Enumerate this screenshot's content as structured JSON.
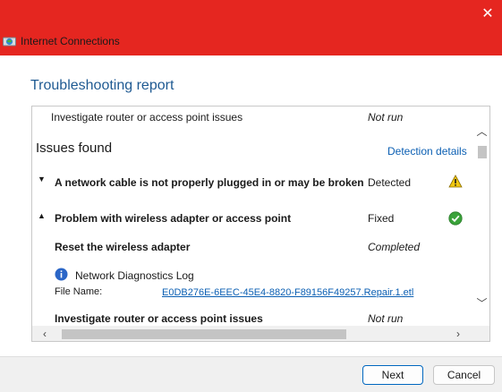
{
  "window": {
    "title": "Internet Connections",
    "close_glyph": "✕",
    "accent_color": "#e52620",
    "icon": "network-globe-icon"
  },
  "report_title": "Troubleshooting report",
  "top_row": {
    "label": "Investigate router or access point issues",
    "status": "Not run"
  },
  "issues": {
    "heading": "Issues found",
    "details_link": "Detection details",
    "items": [
      {
        "label": "A network cable is not properly plugged in or may be broken",
        "status": "Detected",
        "expanded": false,
        "icon": "warning-icon"
      },
      {
        "label": "Problem with wireless adapter or access point",
        "status": "Fixed",
        "expanded": true,
        "icon": "check-icon"
      }
    ],
    "sub_action": {
      "label": "Reset the wireless adapter",
      "status": "Completed"
    },
    "log": {
      "title": "Network Diagnostics Log",
      "file_label": "File Name:",
      "file_name": "E0DB276E-6EEC-45E4-8820-F89156F49257.Repair.1.etl"
    },
    "bottom_row": {
      "label": "Investigate router or access point issues",
      "status": "Not run"
    }
  },
  "footer": {
    "next_label": "Next",
    "cancel_label": "Cancel"
  }
}
